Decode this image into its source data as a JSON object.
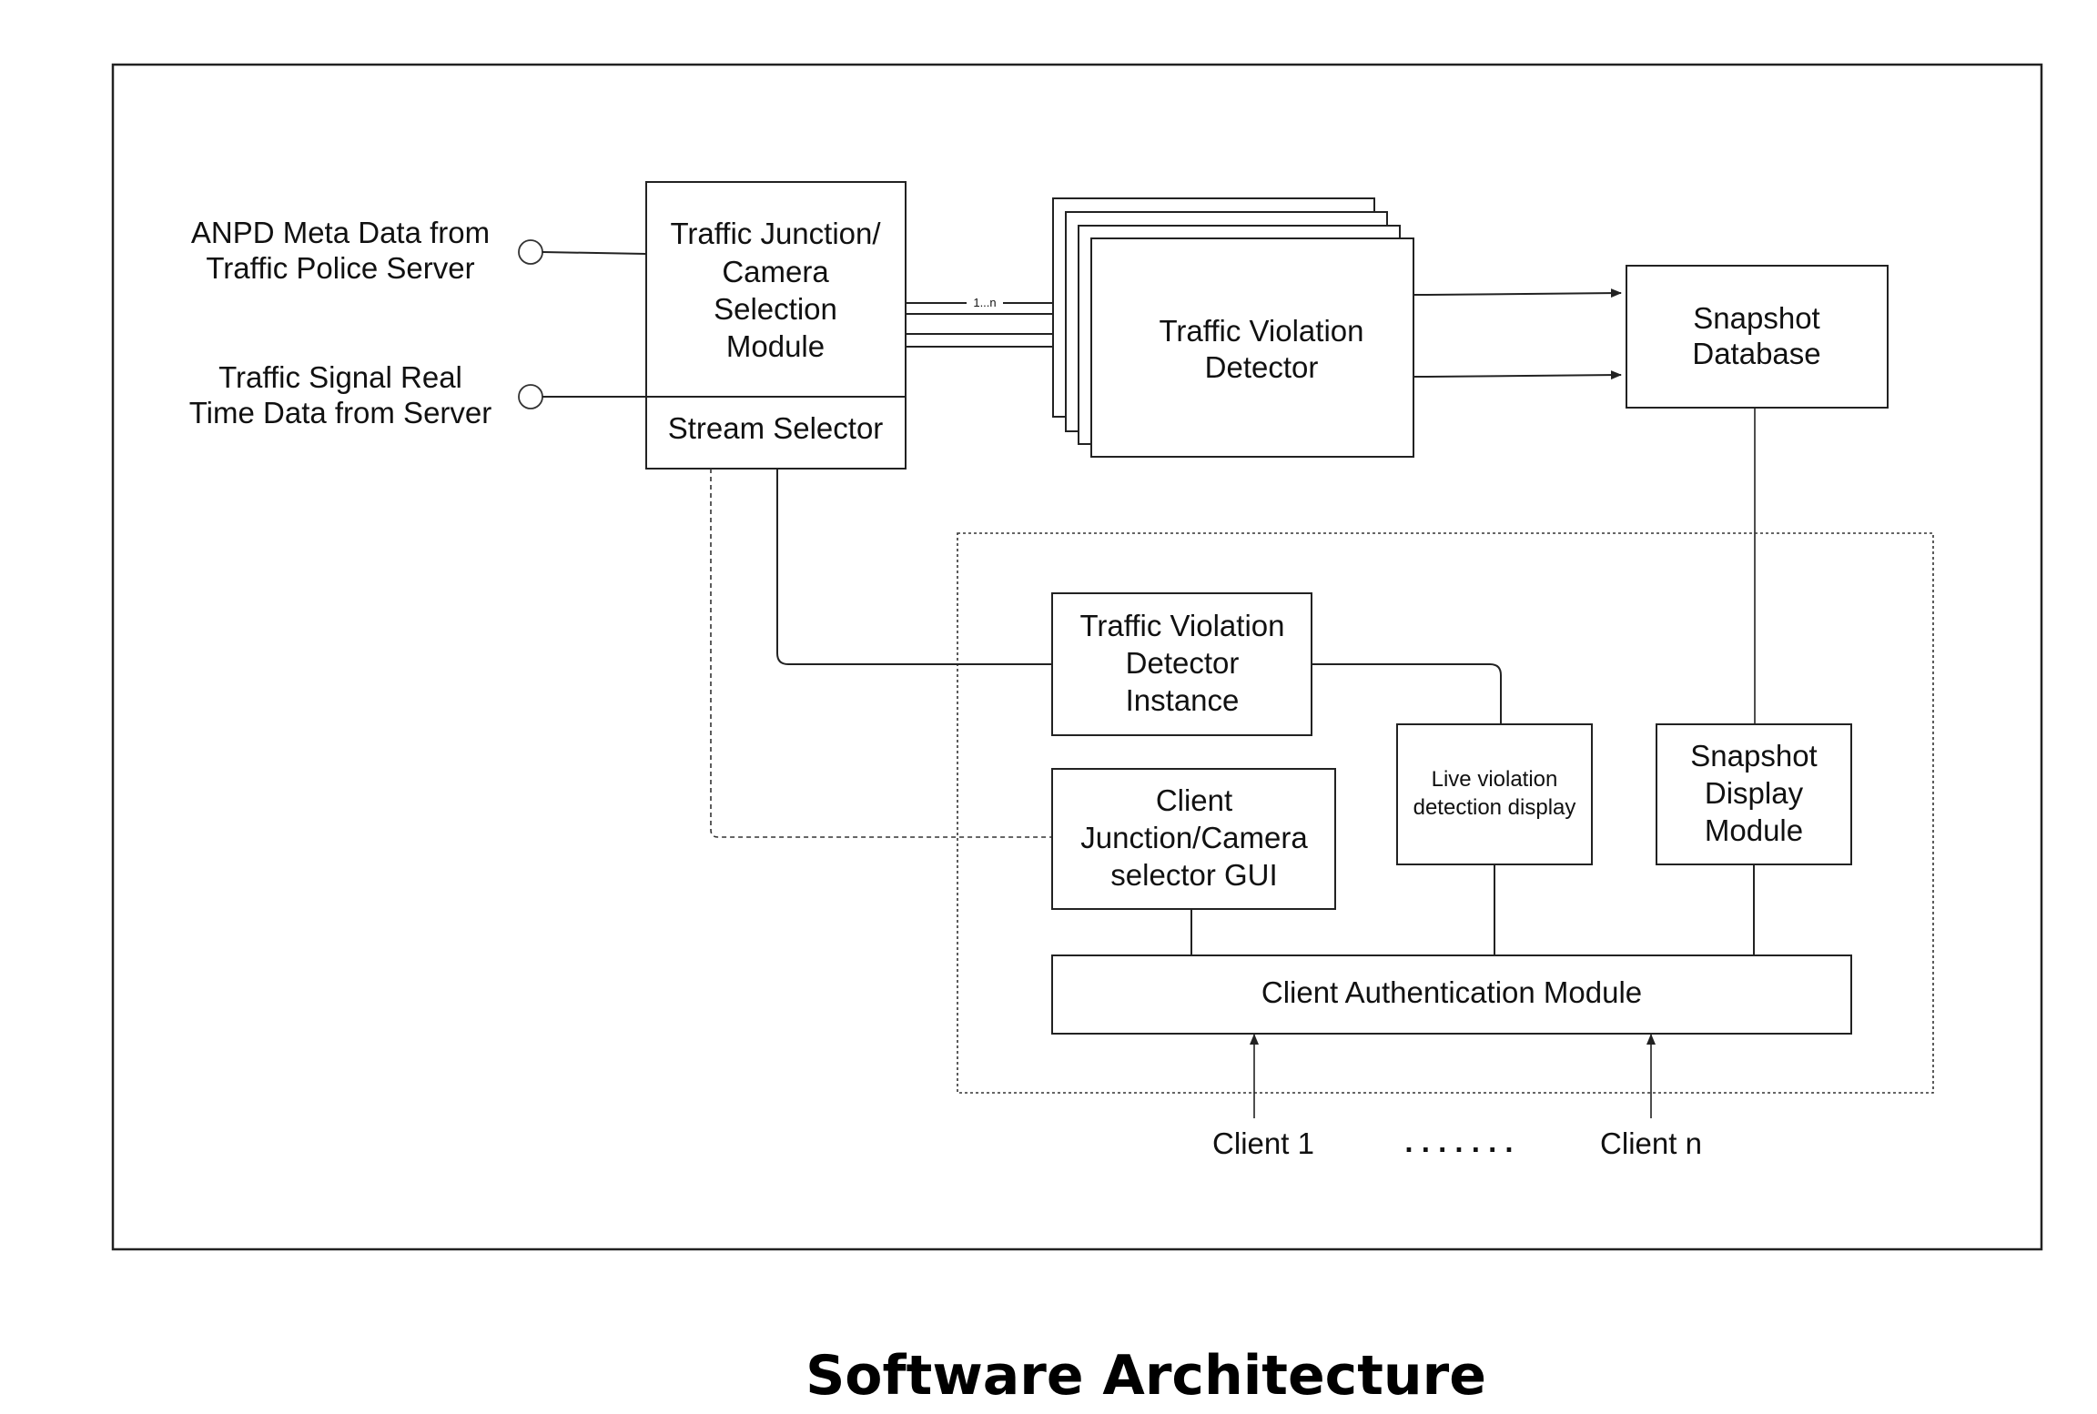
{
  "title": "Software Architecture",
  "inputs": {
    "anpd": [
      "ANPD Meta Data from",
      "Traffic Police Server"
    ],
    "signal": [
      "Traffic Signal Real",
      "Time Data from Server"
    ]
  },
  "modules": {
    "selection": [
      "Traffic Junction/",
      "Camera",
      "Selection",
      "Module"
    ],
    "stream_selector": "Stream Selector",
    "detector": [
      "Traffic Violation",
      "Detector"
    ],
    "multiplicity": "1...n",
    "snapshot_db": [
      "Snapshot",
      "Database"
    ],
    "detector_instance": [
      "Traffic Violation",
      "Detector",
      "Instance"
    ],
    "client_gui": [
      "Client",
      "Junction/Camera",
      "selector GUI"
    ],
    "live_display": [
      "Live violation",
      "detection display"
    ],
    "snapshot_display": [
      "Snapshot",
      "Display",
      "Module"
    ],
    "auth": "Client Authentication Module"
  },
  "clients": {
    "first": "Client 1",
    "ellipsis": ". . . . . . .",
    "last": "Client n"
  }
}
